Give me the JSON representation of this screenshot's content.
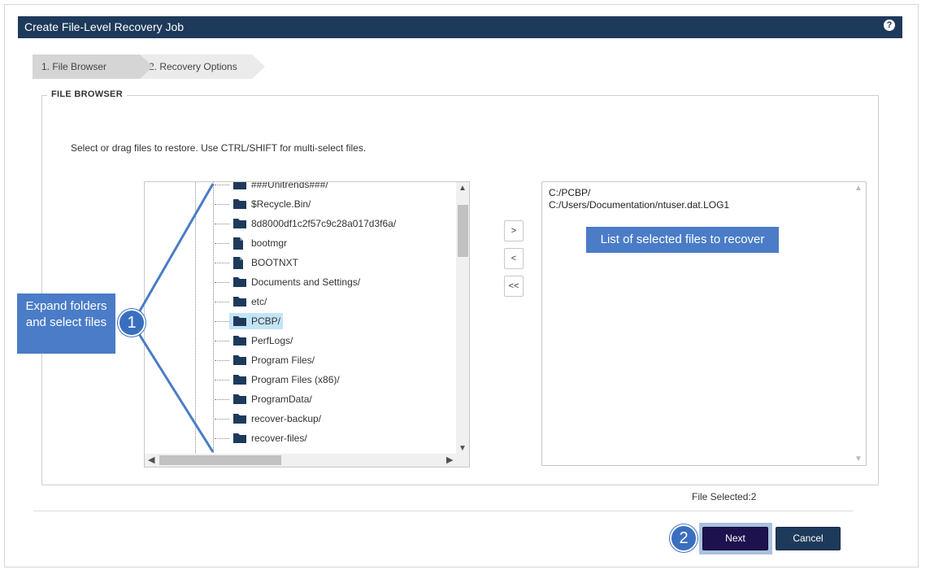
{
  "window": {
    "title": "Create File-Level Recovery Job",
    "help_icon": "question-circle-icon"
  },
  "wizard": {
    "steps": [
      {
        "label": "1. File Browser",
        "active": true
      },
      {
        "label": "2. Recovery Options",
        "active": false
      }
    ]
  },
  "file_browser": {
    "legend": "FILE BROWSER",
    "instructions": "Select or drag files to restore. Use CTRL/SHIFT for multi-select files.",
    "tree": [
      {
        "label": "###Unitrends###/",
        "type": "folder"
      },
      {
        "label": "$Recycle.Bin/",
        "type": "folder"
      },
      {
        "label": "8d8000df1c2f57c9c28a017d3f6a/",
        "type": "folder"
      },
      {
        "label": "bootmgr",
        "type": "file"
      },
      {
        "label": "BOOTNXT",
        "type": "file"
      },
      {
        "label": "Documents and Settings/",
        "type": "folder"
      },
      {
        "label": "etc/",
        "type": "folder"
      },
      {
        "label": "PCBP/",
        "type": "folder",
        "selected": true
      },
      {
        "label": "PerfLogs/",
        "type": "folder"
      },
      {
        "label": "Program Files/",
        "type": "folder"
      },
      {
        "label": "Program Files (x86)/",
        "type": "folder"
      },
      {
        "label": "ProgramData/",
        "type": "folder"
      },
      {
        "label": "recover-backup/",
        "type": "folder"
      },
      {
        "label": "recover-files/",
        "type": "folder"
      }
    ],
    "move_buttons": {
      "add": ">",
      "remove": "<",
      "remove_all": "<<"
    },
    "selected_files": [
      "C:/PCBP/",
      "C:/Users/Documentation/ntuser.dat.LOG1"
    ]
  },
  "callouts": {
    "expand": "Expand folders and select files",
    "selected_list": "List of selected files to recover",
    "badge_1": "1",
    "badge_2": "2"
  },
  "status": {
    "file_selected": "File Selected:2"
  },
  "buttons": {
    "next": "Next",
    "cancel": "Cancel"
  },
  "colors": {
    "title_bar": "#1e3a5b",
    "next_button": "#1e124e",
    "cancel_button": "#1e3a5b",
    "callout": "#4a7cc7",
    "selected_node": "#c3e4f7"
  }
}
